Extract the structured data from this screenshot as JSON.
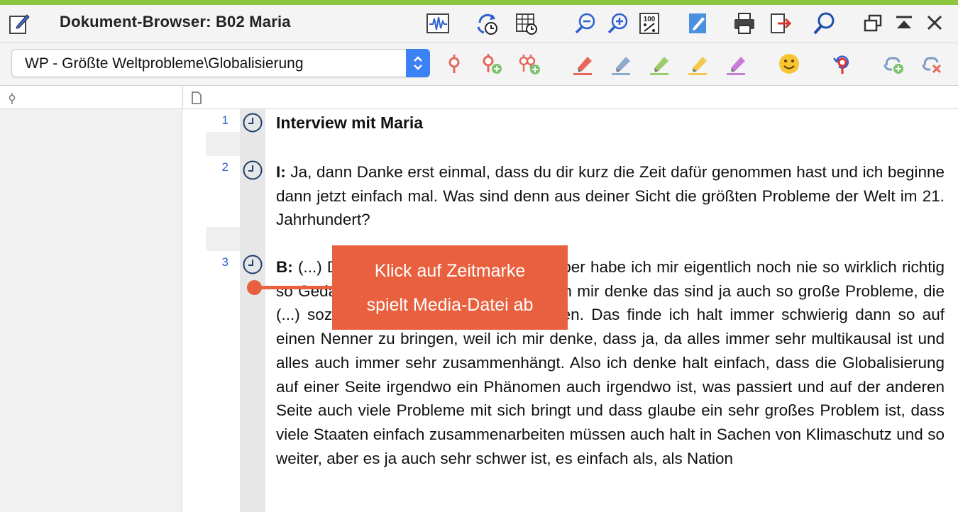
{
  "window": {
    "title": "Dokument-Browser: B02 Maria",
    "accent_color": "#8cc63f"
  },
  "titlebar_icons": [
    "audio-waveform-icon",
    "sync-timestamps-icon",
    "timestamp-table-icon",
    "zoom-out-icon",
    "zoom-in-icon",
    "zoom-100-icon",
    "edit-mode-icon",
    "print-icon",
    "export-icon",
    "search-icon",
    "new-window-icon",
    "collapse-icon",
    "close-icon"
  ],
  "toolbar": {
    "code_selector": {
      "value": "WP - Größte Weltprobleme\\Globalisierung"
    },
    "icons": [
      "code-icon",
      "code-with-new-icon",
      "new-code-icon",
      "highlight-red-icon",
      "highlight-blue-icon",
      "highlight-green-icon",
      "highlight-yellow-icon",
      "highlight-purple-icon",
      "emoticode-icon",
      "undo-coding-icon",
      "link-add-icon",
      "link-remove-icon"
    ]
  },
  "document": {
    "paragraphs": [
      {
        "number": "1",
        "speaker": "",
        "text": "Interview mit Maria"
      },
      {
        "number": "2",
        "speaker": "I:",
        "text": " Ja, dann Danke erst einmal, dass du dir kurz die Zeit dafür genommen hast und ich beginne dann jetzt einfach mal. Was sind denn aus deiner Sicht die größten Probleme der Welt im 21. Jahrhundert?"
      },
      {
        "number": "3",
        "speaker": "B:",
        "text": " (...) Die größten Probleme? (...) Darüber habe ich mir eigentlich noch nie so wirklich richtig so Gedanken gemacht, vor allem weil ich mir denke das sind ja auch so große Probleme, die (...) sozusagen die ganze Welt umfassen. Das finde ich halt immer schwierig dann so auf einen Nenner zu bringen, weil ich mir denke, dass ja, da alles immer sehr multikausal ist und alles auch immer sehr zusammenhängt. Also ich denke halt einfach, dass die Globalisierung auf einer Seite irgendwo ein Phänomen auch irgendwo ist, was passiert und auf der anderen Seite auch viele Probleme mit sich bringt und dass glaube ein sehr großes Problem ist, dass viele Staaten einfach zusammenarbeiten müssen auch halt in Sachen von Klimaschutz und so weiter, aber es ja auch sehr schwer ist, es einfach als, als Nation"
      }
    ]
  },
  "callout": {
    "line1": "Klick auf Zeitmarke",
    "line2": "spielt Media-Datei ab",
    "color": "#e8603e"
  }
}
